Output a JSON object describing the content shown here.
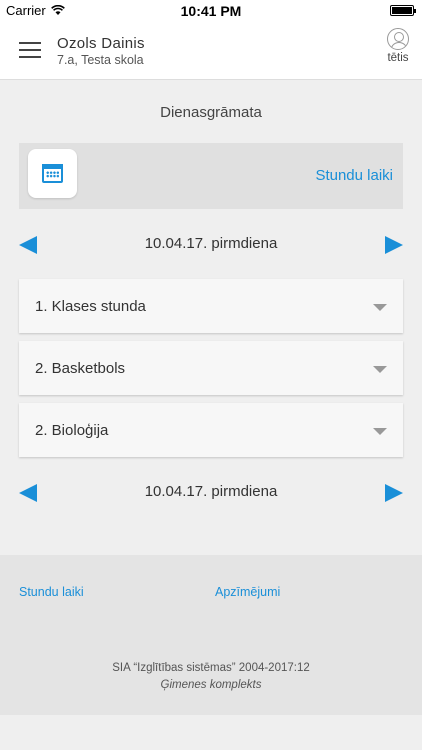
{
  "status_bar": {
    "carrier": "Carrier",
    "time": "10:41 PM"
  },
  "header": {
    "user_name": "Ozols Dainis",
    "user_class": "7.a, Testa skola",
    "profile_label": "tētis"
  },
  "main": {
    "title": "Dienasgrāmata",
    "schedule_link": "Stundu laiki",
    "date_top": "10.04.17. pirmdiena",
    "date_bottom": "10.04.17. pirmdiena",
    "lessons": [
      {
        "label": "1. Klases stunda"
      },
      {
        "label": "2. Basketbols"
      },
      {
        "label": "2. Bioloģija"
      }
    ]
  },
  "footer": {
    "link_schedule": "Stundu laiki",
    "link_legend": "Apzīmējumi",
    "copyright": "SIA “Izglītības sistēmas” 2004-2017:12",
    "subtitle": "Ģimenes komplekts"
  },
  "colors": {
    "accent": "#1a8fd8"
  },
  "icons": [
    "wifi-icon",
    "battery-icon",
    "menu-icon",
    "avatar-icon",
    "calendar-icon",
    "arrow-left-icon",
    "arrow-right-icon",
    "chevron-down-icon"
  ]
}
